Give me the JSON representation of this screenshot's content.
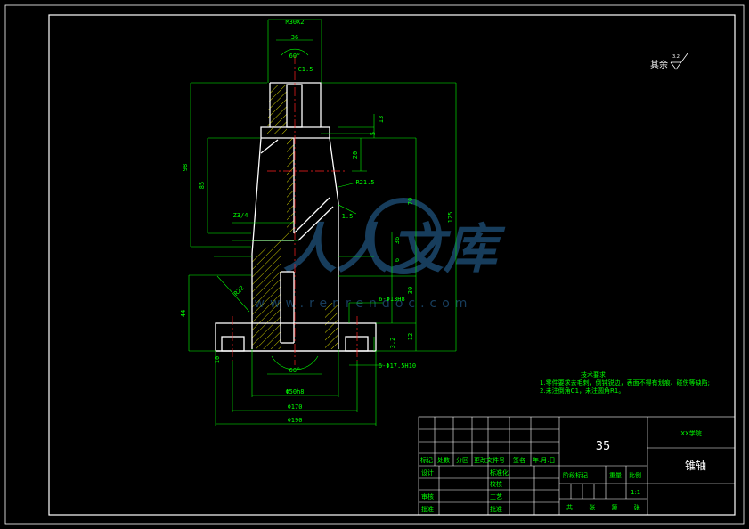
{
  "drawing": {
    "part_name": "锥轴",
    "material": "35",
    "school": "XX学院",
    "scale": "1:1",
    "roughness_label": "其余",
    "roughness_value": "3.2"
  },
  "dimensions": {
    "top_thread": "M30X2",
    "d36_top": "36",
    "angle_top": "60°",
    "chamfer": "C1.5",
    "h_left_98": "98",
    "h_left_85": "85",
    "z_thread": "Z3/4",
    "h_left_44": "44",
    "r_22": "R22",
    "d_10": "10",
    "d_13": "13",
    "d_5": "5",
    "h_20": "20",
    "r_21_5": "R21.5",
    "d_1_5": "1.5",
    "h_70": "70",
    "h_125": "125",
    "d_36_mid": "36",
    "d_6": "6",
    "h_30": "30",
    "holes_top": "6-Φ13H8",
    "ra_3_2": "3.2",
    "h_12": "12",
    "holes_bottom": "6-Φ17.5H10",
    "angle_bottom": "60°",
    "d_50": "Φ50h8",
    "d_170": "Φ170",
    "d_190": "Φ190"
  },
  "tech_req": {
    "title": "技术要求",
    "line1": "1.零件要求去毛刺，倒钝锐边，表面不得有划痕、碰伤等缺陷;",
    "line2": "2.未注倒角C1，未注圆角R1。"
  },
  "title_block": {
    "mark": "标记",
    "count": "处数",
    "zone": "分区",
    "doc_no": "更改文件号",
    "sign": "签名",
    "date": "年.月.日",
    "design": "设计",
    "standardize": "标准化",
    "proofread": "校核",
    "process": "工艺",
    "review": "审核",
    "approve": "批准",
    "stage_mark": "阶段标记",
    "weight": "重量",
    "scale_label": "比例",
    "sheets": "共 张 第 张"
  },
  "watermark": {
    "text": "人人文库",
    "url": "www.renrendoc.com"
  }
}
